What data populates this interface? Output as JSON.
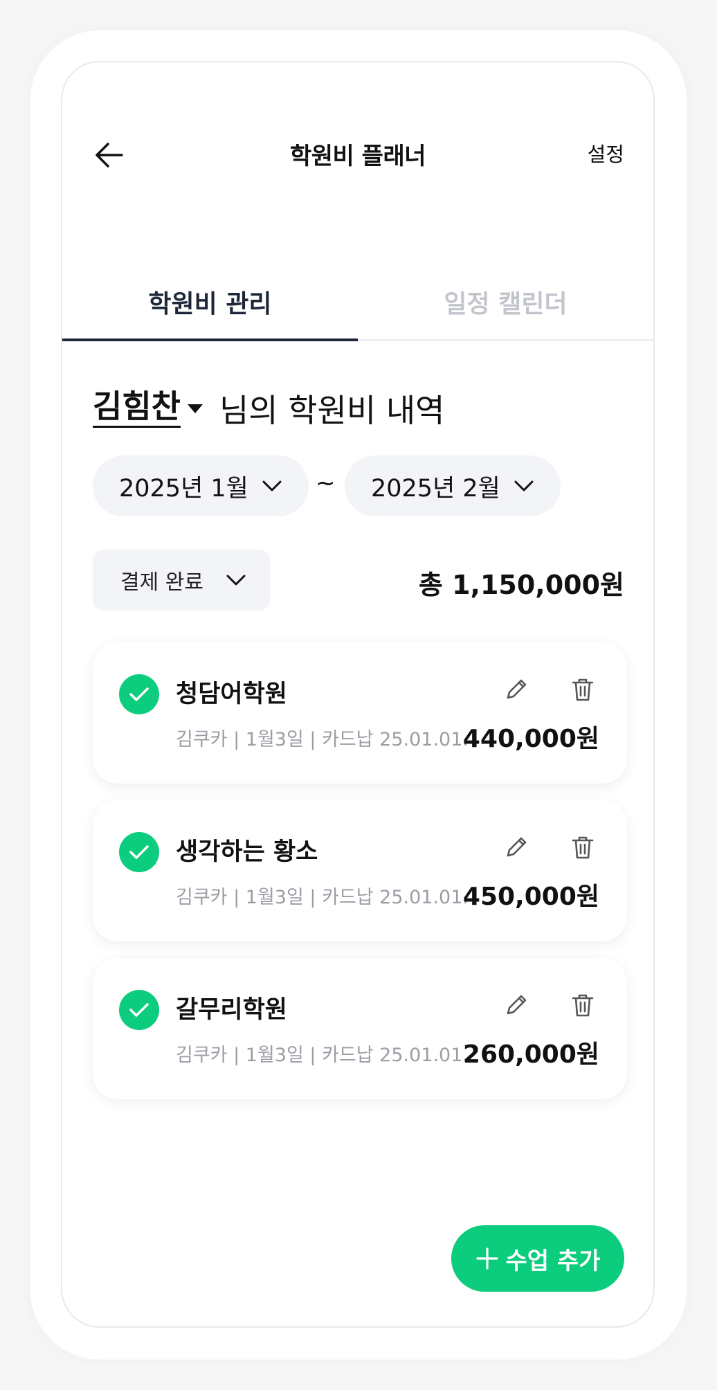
{
  "header": {
    "title": "학원비 플래너",
    "settings_label": "설정"
  },
  "tabs": [
    {
      "label": "학원비 관리",
      "active": true
    },
    {
      "label": "일정 캘린더",
      "active": false
    }
  ],
  "student": {
    "name": "김힘찬",
    "suffix": "님의 학원비 내역"
  },
  "period": {
    "start": "2025년 1월",
    "separator": "~",
    "end": "2025년 2월"
  },
  "filter": {
    "status": "결제 완료"
  },
  "total": "총 1,150,000원",
  "academies": [
    {
      "name": "청담어학원",
      "meta": "김쿠카 | 1월3일 | 카드납 25.01.01.",
      "amount": "440,000원"
    },
    {
      "name": "생각하는 황소",
      "meta": "김쿠카 | 1월3일 | 카드납 25.01.01.",
      "amount": "450,000원"
    },
    {
      "name": "갈무리학원",
      "meta": "김쿠카 | 1월3일 | 카드납 25.01.01.",
      "amount": "260,000원"
    }
  ],
  "fab": {
    "label": "수업 추가"
  },
  "icons": {
    "back": "arrow-left-icon",
    "dropdown": "chevron-down-icon",
    "check": "check-circle-icon",
    "edit": "pencil-icon",
    "delete": "trash-icon",
    "add": "plus-icon"
  },
  "colors": {
    "accent": "#0bcd7d",
    "primary_text": "#1e2739",
    "muted_text": "#9a9da3",
    "pill_bg": "#f3f4f7"
  }
}
